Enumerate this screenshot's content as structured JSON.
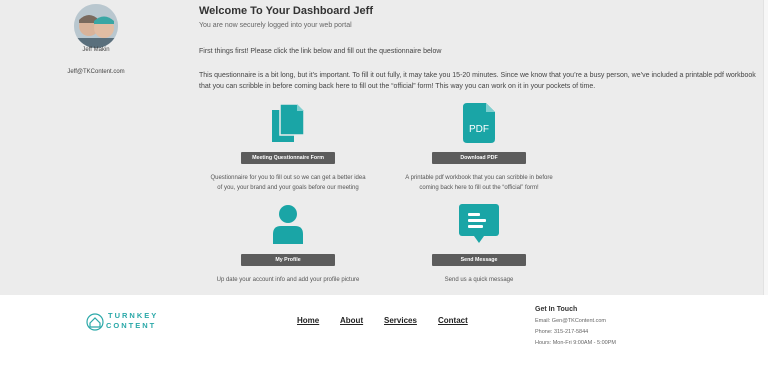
{
  "user": {
    "name": "Jeff Makin",
    "email": "Jeff@TKContent.com"
  },
  "header": {
    "title": "Welcome To Your Dashboard Jeff",
    "subtitle": "You are now securely logged into your web portal"
  },
  "intro": "First things first! Please click the link below and fill out the questionnaire below",
  "description": "This questionnaire is a bit long, but it’s important. To fill it out fully, it may take you 15-20 minutes. Since we know that you’re a busy person, we’ve included a printable pdf workbook that you can scribble in before coming back here to fill out the “official” form! This way you can work on it in your pockets of time.",
  "cards": [
    {
      "icon": "documents-icon",
      "button": "Meeting Questionnaire Form",
      "desc1": "Questionnaire for you to fill out so we can get a better idea",
      "desc2": "of you, your brand and your goals before our meeting"
    },
    {
      "icon": "pdf-icon",
      "icon_text": "PDF",
      "button": "Download PDF",
      "desc1": "A printable pdf workbook that you can scribble in before",
      "desc2": "coming back here to fill out the “official” form!"
    },
    {
      "icon": "user-icon",
      "button": "My Profile",
      "desc1": "Up date your account info and add your profile picture",
      "desc2": ""
    },
    {
      "icon": "message-icon",
      "button": "Send Message",
      "desc1": "Send us a quick message",
      "desc2": ""
    }
  ],
  "footer": {
    "logo_line1": "TURNKEY",
    "logo_line2": "CONTENT",
    "nav": [
      "Home",
      "About",
      "Services",
      "Contact"
    ],
    "contact_title": "Get In Touch",
    "email": "Email: Gen@TKContent.com",
    "phone": "Phone: 315-217-5844",
    "hours": "Hours: Mon-Fri 9:00AM - 5:00PM"
  },
  "colors": {
    "accent": "#1aa5a6",
    "button_bg": "#5c5c5c",
    "main_bg": "#ececec"
  }
}
